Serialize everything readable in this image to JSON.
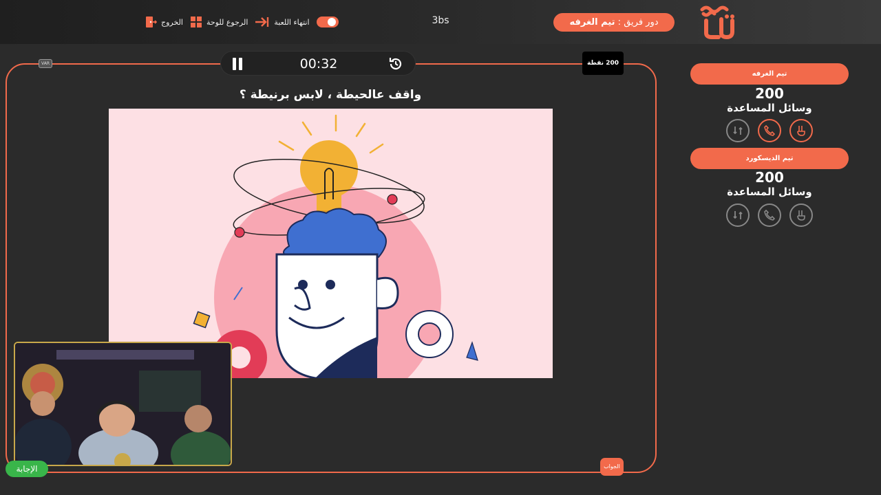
{
  "header": {
    "turn_prefix": "دور فريق : ",
    "turn_team": "تيم الغرفه",
    "game_name": "3bs",
    "end_game_label": "انتهاء اللعبة",
    "back_to_board_label": "الرجوع للوحة",
    "exit_label": "الخروج"
  },
  "board": {
    "timer": "00:32",
    "var_label": "VAR",
    "points_badge": "200 نقطة",
    "question": "واقف عالحيطة ، لابس برنيطة ؟",
    "answer_button": "الجواب"
  },
  "webcam": {
    "label": "الإجابة"
  },
  "teams": [
    {
      "name": "تيم الغرفه",
      "score": "200",
      "help_label": "وسائل المساعدة",
      "helps": [
        "two-fingers-icon",
        "phone-icon",
        "swap-turn-icon"
      ],
      "active_helps": [
        true,
        true,
        false
      ]
    },
    {
      "name": "تيم الديسكورد",
      "score": "200",
      "help_label": "وسائل المساعدة",
      "helps": [
        "two-fingers-icon",
        "phone-icon",
        "swap-turn-icon"
      ],
      "active_helps": [
        false,
        false,
        false
      ]
    }
  ],
  "colors": {
    "accent": "#f26a4b",
    "background": "#2b2b2b",
    "image_bg": "#fde0e4",
    "brain": "#3f6fd0",
    "bulb": "#f2b134"
  }
}
